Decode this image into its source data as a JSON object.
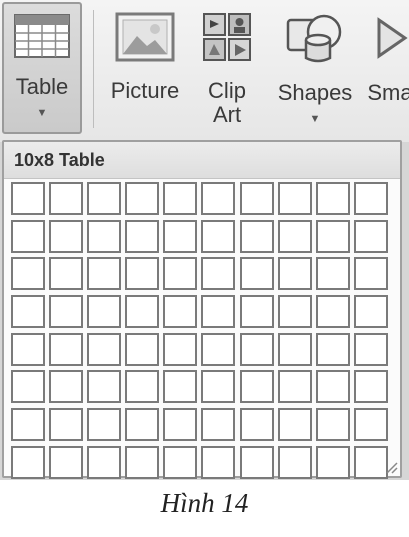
{
  "ribbon": {
    "table_button": {
      "label": "Table",
      "icon": "table-grid-icon"
    },
    "picture_button": {
      "label": "Picture",
      "icon": "picture-icon"
    },
    "clipart_button": {
      "label_line1": "Clip",
      "label_line2": "Art",
      "icon": "clip-art-icon"
    },
    "shapes_button": {
      "label": "Shapes",
      "icon": "shapes-icon"
    },
    "smartart_button": {
      "label": "Sma",
      "icon": "smartart-icon"
    }
  },
  "table_dropdown": {
    "title": "10x8 Table",
    "columns": 10,
    "rows": 8
  },
  "caption": "Hình 14"
}
